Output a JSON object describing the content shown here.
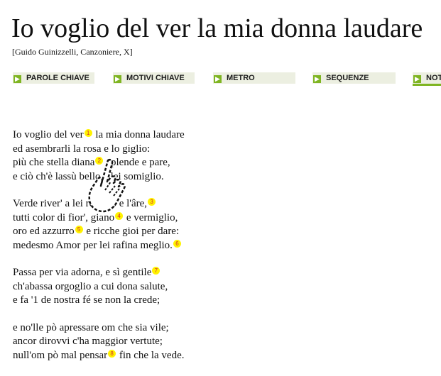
{
  "header": {
    "title": "Io voglio del ver la mia donna laudare",
    "subtitle": "[Guido Guinizzelli, Canzoniere, X]"
  },
  "nav": {
    "tabs": [
      {
        "label": "PAROLE CHIAVE"
      },
      {
        "label": "MOTIVI CHIAVE"
      },
      {
        "label": "METRO"
      },
      {
        "label": "SEQUENZE"
      },
      {
        "label": "NOTE"
      }
    ],
    "accent_color": "#7fb522",
    "tab_background": "#ecefe1"
  },
  "poem": {
    "stanzas": [
      {
        "lines": [
          {
            "before": "Io voglio del ver",
            "note": "1",
            "after": " la mia donna laudare"
          },
          {
            "text": "ed asembrarli la rosa e lo giglio:"
          },
          {
            "before": "più che stella diana",
            "note": "2",
            "after": " splende e pare,"
          },
          {
            "text": "e ciò ch'è lassù bello a lei somiglio."
          }
        ]
      },
      {
        "lines": [
          {
            "before": "Verde river' a lei rembro e l'âre,",
            "note": "3",
            "after": ""
          },
          {
            "before": "tutti color di fior', giano",
            "note": "4",
            "after": " e vermiglio,"
          },
          {
            "before": "oro ed azzurro",
            "note": "5",
            "after": " e ricche gioi per dare:"
          },
          {
            "before": "medesmo Amor per lei rafina meglio.",
            "note": "6",
            "after": ""
          }
        ]
      },
      {
        "lines": [
          {
            "before": "Passa per via adorna, e sì gentile",
            "note": "7",
            "after": ""
          },
          {
            "text": "ch'abassa orgoglio a cui dona salute,"
          },
          {
            "text": "e fa '1 de nostra fé se non la crede;"
          }
        ]
      },
      {
        "lines": [
          {
            "text": "e no'lle pò apressare om che sia vile;"
          },
          {
            "text": "ancor dirovvi c'ha maggior vertute;"
          },
          {
            "before": "null'om pò mal pensar",
            "note": "8",
            "after": " fin che la vede."
          }
        ]
      }
    ],
    "note_bg": "#fff200",
    "note_color": "#d42b2b"
  },
  "cursor": {
    "icon": "hand-pointer-icon"
  }
}
